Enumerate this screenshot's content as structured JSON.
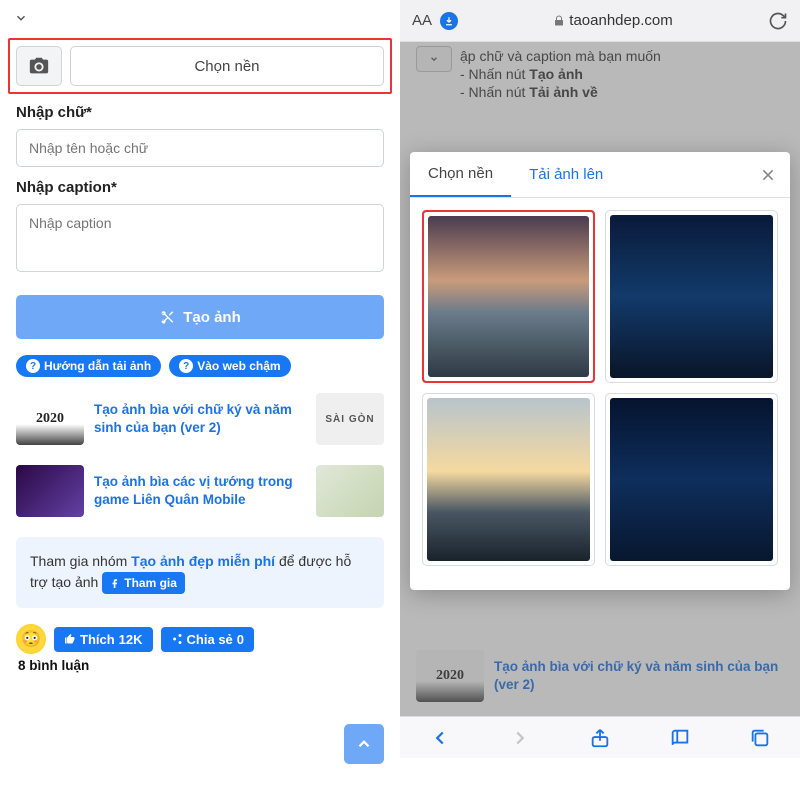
{
  "left": {
    "choose_bg_label": "Chọn nền",
    "text_label": "Nhập chữ*",
    "text_placeholder": "Nhập tên hoặc chữ",
    "caption_label": "Nhập caption*",
    "caption_placeholder": "Nhập caption",
    "create_btn": "Tạo ảnh",
    "help_pill_1": "Hướng dẫn tải ảnh",
    "help_pill_2": "Vào web chậm",
    "related": [
      {
        "title": "Tạo ảnh bìa với chữ ký và năm sinh của bạn (ver 2)",
        "thumb1": "2020",
        "thumb2": "SÀI GÒN"
      },
      {
        "title": "Tạo ảnh bìa các vị tướng trong game Liên Quân Mobile"
      }
    ],
    "group_text_1": "Tham gia nhóm ",
    "group_text_bold": "Tạo ảnh đẹp miễn phí",
    "group_text_2": " để được hỗ trợ tạo ảnh",
    "join_label": "Tham gia",
    "like_label": "Thích",
    "like_count": "12K",
    "share_label": "Chia sẻ",
    "share_count": "0",
    "comments": "8 bình luận"
  },
  "right": {
    "aa": "AA",
    "url": "taoanhdep.com",
    "bg_lines": [
      "ập chữ và caption mà bạn muốn",
      "- Nhấn nút Tạo ảnh",
      "- Nhấn nút Tải ảnh về"
    ],
    "bg_bold_1": "Tạo ảnh",
    "bg_bold_2": "Tải ảnh về",
    "bg_related": "Tạo ảnh bìa với chữ ký và năm sinh của bạn (ver 2)",
    "modal": {
      "tab_active": "Chọn nền",
      "tab_upload": "Tải ảnh lên"
    }
  }
}
